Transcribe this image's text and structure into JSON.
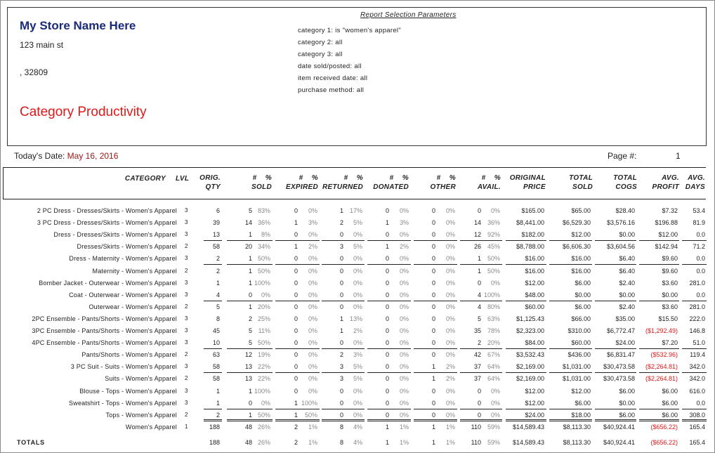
{
  "store": {
    "name": "My Store Name Here",
    "address": "123 main st",
    "city_zip": ",  32809",
    "report_title": "Category Productivity"
  },
  "params": {
    "title": "Report Selection Parameters",
    "lines": [
      "category 1: is \"women's apparel\"",
      "category 2: all",
      "category 3: all",
      "date sold/posted: all",
      "item received date: all",
      "purchase method: all"
    ]
  },
  "meta": {
    "date_label": "Today's Date:",
    "date_value": "May 16, 2016",
    "page_label": "Page #:",
    "page_value": "1"
  },
  "columns": {
    "category": "CATEGORY",
    "lvl": "LVL",
    "orig_qty": [
      "ORIG.",
      "QTY"
    ],
    "sold": [
      "#    %",
      "SOLD"
    ],
    "expired": [
      "#    %",
      "EXPIRED"
    ],
    "returned": [
      "#    %",
      "RETURNED"
    ],
    "donated": [
      "#    %",
      "DONATED"
    ],
    "other": [
      "#    %",
      "OTHER"
    ],
    "avail": [
      "#    %",
      "AVAIL."
    ],
    "original_price": [
      "ORIGINAL",
      "PRICE"
    ],
    "total_sold": [
      "TOTAL",
      "SOLD"
    ],
    "total_cogs": [
      "TOTAL",
      "COGS"
    ],
    "avg_profit": [
      "AVG.",
      "PROFIT"
    ],
    "avg_days": [
      "AVG.",
      "DAYS"
    ]
  },
  "rows": [
    {
      "category": "2 PC Dress - Dresses/Skirts - Women's Apparel",
      "lvl": "3",
      "qty": "6",
      "sold": "5",
      "sold_p": "83%",
      "exp": "0",
      "exp_p": "0%",
      "ret": "1",
      "ret_p": "17%",
      "don": "0",
      "don_p": "0%",
      "oth": "0",
      "oth_p": "0%",
      "av": "0",
      "av_p": "0%",
      "price": "$165.00",
      "tsold": "$65.00",
      "cogs": "$28.40",
      "profit": "$7.32",
      "days": "53.4",
      "neg": false,
      "rule": false
    },
    {
      "category": "3 PC Dress - Dresses/Skirts - Women's Apparel",
      "lvl": "3",
      "qty": "39",
      "sold": "14",
      "sold_p": "36%",
      "exp": "1",
      "exp_p": "3%",
      "ret": "2",
      "ret_p": "5%",
      "don": "1",
      "don_p": "3%",
      "oth": "0",
      "oth_p": "0%",
      "av": "14",
      "av_p": "36%",
      "price": "$8,441.00",
      "tsold": "$6,529.30",
      "cogs": "$3,576.16",
      "profit": "$196.88",
      "days": "81.9",
      "neg": false,
      "rule": false
    },
    {
      "category": "Dress - Dresses/Skirts - Women's Apparel",
      "lvl": "3",
      "qty": "13",
      "sold": "1",
      "sold_p": "8%",
      "exp": "0",
      "exp_p": "0%",
      "ret": "0",
      "ret_p": "0%",
      "don": "0",
      "don_p": "0%",
      "oth": "0",
      "oth_p": "0%",
      "av": "12",
      "av_p": "92%",
      "price": "$182.00",
      "tsold": "$12.00",
      "cogs": "$0.00",
      "profit": "$12.00",
      "days": "0.0",
      "neg": false,
      "rule": true
    },
    {
      "category": "Dresses/Skirts - Women's Apparel",
      "lvl": "2",
      "qty": "58",
      "sold": "20",
      "sold_p": "34%",
      "exp": "1",
      "exp_p": "2%",
      "ret": "3",
      "ret_p": "5%",
      "don": "1",
      "don_p": "2%",
      "oth": "0",
      "oth_p": "0%",
      "av": "26",
      "av_p": "45%",
      "price": "$8,788.00",
      "tsold": "$6,606.30",
      "cogs": "$3,604.56",
      "profit": "$142.94",
      "days": "71.2",
      "neg": false,
      "rule": false
    },
    {
      "category": "Dress - Maternity - Women's Apparel",
      "lvl": "3",
      "qty": "2",
      "sold": "1",
      "sold_p": "50%",
      "exp": "0",
      "exp_p": "0%",
      "ret": "0",
      "ret_p": "0%",
      "don": "0",
      "don_p": "0%",
      "oth": "0",
      "oth_p": "0%",
      "av": "1",
      "av_p": "50%",
      "price": "$16.00",
      "tsold": "$16.00",
      "cogs": "$6.40",
      "profit": "$9.60",
      "days": "0.0",
      "neg": false,
      "rule": true
    },
    {
      "category": "Maternity - Women's Apparel",
      "lvl": "2",
      "qty": "2",
      "sold": "1",
      "sold_p": "50%",
      "exp": "0",
      "exp_p": "0%",
      "ret": "0",
      "ret_p": "0%",
      "don": "0",
      "don_p": "0%",
      "oth": "0",
      "oth_p": "0%",
      "av": "1",
      "av_p": "50%",
      "price": "$16.00",
      "tsold": "$16.00",
      "cogs": "$6.40",
      "profit": "$9.60",
      "days": "0.0",
      "neg": false,
      "rule": false
    },
    {
      "category": "Bomber Jacket - Outerwear - Women's Apparel",
      "lvl": "3",
      "qty": "1",
      "sold": "1",
      "sold_p": "100%",
      "exp": "0",
      "exp_p": "0%",
      "ret": "0",
      "ret_p": "0%",
      "don": "0",
      "don_p": "0%",
      "oth": "0",
      "oth_p": "0%",
      "av": "0",
      "av_p": "0%",
      "price": "$12.00",
      "tsold": "$6.00",
      "cogs": "$2.40",
      "profit": "$3.60",
      "days": "281.0",
      "neg": false,
      "rule": false
    },
    {
      "category": "Coat - Outerwear - Women's Apparel",
      "lvl": "3",
      "qty": "4",
      "sold": "0",
      "sold_p": "0%",
      "exp": "0",
      "exp_p": "0%",
      "ret": "0",
      "ret_p": "0%",
      "don": "0",
      "don_p": "0%",
      "oth": "0",
      "oth_p": "0%",
      "av": "4",
      "av_p": "100%",
      "price": "$48.00",
      "tsold": "$0.00",
      "cogs": "$0.00",
      "profit": "$0.00",
      "days": "0.0",
      "neg": false,
      "rule": true
    },
    {
      "category": "Outerwear - Women's Apparel",
      "lvl": "2",
      "qty": "5",
      "sold": "1",
      "sold_p": "20%",
      "exp": "0",
      "exp_p": "0%",
      "ret": "0",
      "ret_p": "0%",
      "don": "0",
      "don_p": "0%",
      "oth": "0",
      "oth_p": "0%",
      "av": "4",
      "av_p": "80%",
      "price": "$60.00",
      "tsold": "$6.00",
      "cogs": "$2.40",
      "profit": "$3.60",
      "days": "281.0",
      "neg": false,
      "rule": false
    },
    {
      "category": "2PC Ensemble - Pants/Shorts - Women's Apparel",
      "lvl": "3",
      "qty": "8",
      "sold": "2",
      "sold_p": "25%",
      "exp": "0",
      "exp_p": "0%",
      "ret": "1",
      "ret_p": "13%",
      "don": "0",
      "don_p": "0%",
      "oth": "0",
      "oth_p": "0%",
      "av": "5",
      "av_p": "63%",
      "price": "$1,125.43",
      "tsold": "$66.00",
      "cogs": "$35.00",
      "profit": "$15.50",
      "days": "222.0",
      "neg": false,
      "rule": false
    },
    {
      "category": "3PC Ensemble - Pants/Shorts - Women's Apparel",
      "lvl": "3",
      "qty": "45",
      "sold": "5",
      "sold_p": "11%",
      "exp": "0",
      "exp_p": "0%",
      "ret": "1",
      "ret_p": "2%",
      "don": "0",
      "don_p": "0%",
      "oth": "0",
      "oth_p": "0%",
      "av": "35",
      "av_p": "78%",
      "price": "$2,323.00",
      "tsold": "$310.00",
      "cogs": "$6,772.47",
      "profit": "($1,292.49)",
      "days": "146.8",
      "neg": true,
      "rule": false
    },
    {
      "category": "4PC Ensemble - Pants/Shorts - Women's Apparel",
      "lvl": "3",
      "qty": "10",
      "sold": "5",
      "sold_p": "50%",
      "exp": "0",
      "exp_p": "0%",
      "ret": "0",
      "ret_p": "0%",
      "don": "0",
      "don_p": "0%",
      "oth": "0",
      "oth_p": "0%",
      "av": "2",
      "av_p": "20%",
      "price": "$84.00",
      "tsold": "$60.00",
      "cogs": "$24.00",
      "profit": "$7.20",
      "days": "51.0",
      "neg": false,
      "rule": true
    },
    {
      "category": "Pants/Shorts - Women's Apparel",
      "lvl": "2",
      "qty": "63",
      "sold": "12",
      "sold_p": "19%",
      "exp": "0",
      "exp_p": "0%",
      "ret": "2",
      "ret_p": "3%",
      "don": "0",
      "don_p": "0%",
      "oth": "0",
      "oth_p": "0%",
      "av": "42",
      "av_p": "67%",
      "price": "$3,532.43",
      "tsold": "$436.00",
      "cogs": "$6,831.47",
      "profit": "($532.96)",
      "days": "119.4",
      "neg": true,
      "rule": false
    },
    {
      "category": "3 PC Suit - Suits - Women's Apparel",
      "lvl": "3",
      "qty": "58",
      "sold": "13",
      "sold_p": "22%",
      "exp": "0",
      "exp_p": "0%",
      "ret": "3",
      "ret_p": "5%",
      "don": "0",
      "don_p": "0%",
      "oth": "1",
      "oth_p": "2%",
      "av": "37",
      "av_p": "64%",
      "price": "$2,169.00",
      "tsold": "$1,031.00",
      "cogs": "$30,473.58",
      "profit": "($2,264.81)",
      "days": "342.0",
      "neg": true,
      "rule": true
    },
    {
      "category": "Suits - Women's Apparel",
      "lvl": "2",
      "qty": "58",
      "sold": "13",
      "sold_p": "22%",
      "exp": "0",
      "exp_p": "0%",
      "ret": "3",
      "ret_p": "5%",
      "don": "0",
      "don_p": "0%",
      "oth": "1",
      "oth_p": "2%",
      "av": "37",
      "av_p": "64%",
      "price": "$2,169.00",
      "tsold": "$1,031.00",
      "cogs": "$30,473.58",
      "profit": "($2,264.81)",
      "days": "342.0",
      "neg": true,
      "rule": false
    },
    {
      "category": "Blouse - Tops - Women's Apparel",
      "lvl": "3",
      "qty": "1",
      "sold": "1",
      "sold_p": "100%",
      "exp": "0",
      "exp_p": "0%",
      "ret": "0",
      "ret_p": "0%",
      "don": "0",
      "don_p": "0%",
      "oth": "0",
      "oth_p": "0%",
      "av": "0",
      "av_p": "0%",
      "price": "$12.00",
      "tsold": "$12.00",
      "cogs": "$6.00",
      "profit": "$6.00",
      "days": "616.0",
      "neg": false,
      "rule": false
    },
    {
      "category": "Sweatshirt - Tops - Women's Apparel",
      "lvl": "3",
      "qty": "1",
      "sold": "0",
      "sold_p": "0%",
      "exp": "1",
      "exp_p": "100%",
      "ret": "0",
      "ret_p": "0%",
      "don": "0",
      "don_p": "0%",
      "oth": "0",
      "oth_p": "0%",
      "av": "0",
      "av_p": "0%",
      "price": "$12.00",
      "tsold": "$6.00",
      "cogs": "$0.00",
      "profit": "$6.00",
      "days": "0.0",
      "neg": false,
      "rule": true
    },
    {
      "category": "Tops - Women's Apparel",
      "lvl": "2",
      "qty": "2",
      "sold": "1",
      "sold_p": "50%",
      "exp": "1",
      "exp_p": "50%",
      "ret": "0",
      "ret_p": "0%",
      "don": "0",
      "don_p": "0%",
      "oth": "0",
      "oth_p": "0%",
      "av": "0",
      "av_p": "0%",
      "price": "$24.00",
      "tsold": "$18.00",
      "cogs": "$6.00",
      "profit": "$6.00",
      "days": "308.0",
      "neg": false,
      "rule": false
    },
    {
      "category": "Women's Apparel",
      "lvl": "1",
      "qty": "188",
      "sold": "48",
      "sold_p": "26%",
      "exp": "2",
      "exp_p": "1%",
      "ret": "8",
      "ret_p": "4%",
      "don": "1",
      "don_p": "1%",
      "oth": "1",
      "oth_p": "1%",
      "av": "110",
      "av_p": "59%",
      "price": "$14,589.43",
      "tsold": "$8,113.30",
      "cogs": "$40,924.41",
      "profit": "($656.22)",
      "days": "165.4",
      "neg": true,
      "rule": false
    }
  ],
  "totals": {
    "category": "TOTALS",
    "qty": "188",
    "sold": "48",
    "sold_p": "26%",
    "exp": "2",
    "exp_p": "1%",
    "ret": "8",
    "ret_p": "4%",
    "don": "1",
    "don_p": "1%",
    "oth": "1",
    "oth_p": "1%",
    "av": "110",
    "av_p": "59%",
    "price": "$14,589.43",
    "tsold": "$8,113.30",
    "cogs": "$40,924.41",
    "profit": "($656.22)",
    "days": "165.4",
    "neg": true
  }
}
